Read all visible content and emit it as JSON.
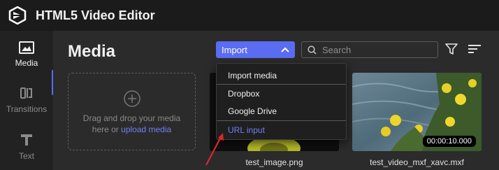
{
  "app": {
    "title": "HTML5 Video Editor",
    "logo_icon": "hexagon-play-logo-icon"
  },
  "sidebar": {
    "items": [
      {
        "label": "Media",
        "icon": "image-icon",
        "active": true
      },
      {
        "label": "Transitions",
        "icon": "transitions-icon",
        "active": false
      },
      {
        "label": "Text",
        "icon": "text-t-icon",
        "active": false
      }
    ]
  },
  "main": {
    "title": "Media",
    "import_label": "Import",
    "search": {
      "placeholder": "Search",
      "value": ""
    },
    "dropzone": {
      "line1": "Drag and drop your media",
      "line2_prefix": "here or ",
      "link": "upload media"
    },
    "thumbs": [
      {
        "filename": "test_image.png"
      },
      {
        "filename": "test_video_mxf_xavc.mxf",
        "duration": "00:00:10.000"
      }
    ]
  },
  "import_menu": {
    "items": [
      "Import media",
      "Dropbox",
      "Google Drive",
      "URL input"
    ],
    "highlighted": "URL input"
  },
  "colors": {
    "accent": "#5a6cf2",
    "link": "#6f80f5",
    "topbar": "#1b1b1b",
    "panel": "#2b2b2b",
    "arrow": "#e0242a"
  }
}
